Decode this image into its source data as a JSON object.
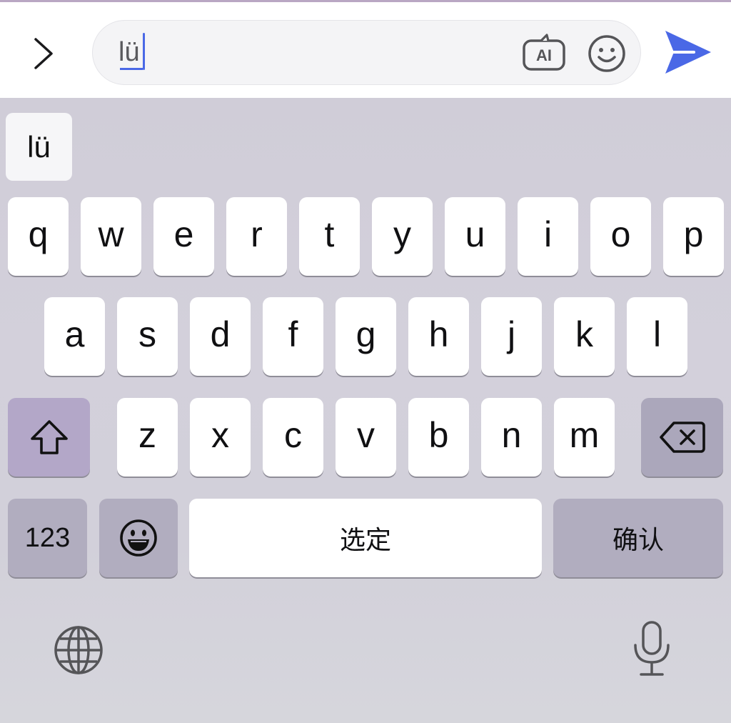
{
  "input_bar": {
    "expand_icon": "chevron-right-icon",
    "field_value": "lü",
    "ai_label": "AI",
    "emoji_icon": "smiley-face-icon",
    "send_icon": "paper-plane-send-icon",
    "send_color": "#4a68e6"
  },
  "keyboard": {
    "candidate": "lü",
    "row1": [
      "q",
      "w",
      "e",
      "r",
      "t",
      "y",
      "u",
      "i",
      "o",
      "p"
    ],
    "row2": [
      "a",
      "s",
      "d",
      "f",
      "g",
      "h",
      "j",
      "k",
      "l"
    ],
    "row3": [
      "z",
      "x",
      "c",
      "v",
      "b",
      "n",
      "m"
    ],
    "shift_icon": "shift-arrow-icon",
    "delete_icon": "backspace-icon",
    "numbers_label": "123",
    "emoji_key_icon": "grinning-face-icon",
    "space_label": "选定",
    "confirm_label": "确认",
    "globe_icon": "globe-icon",
    "mic_icon": "microphone-icon"
  }
}
